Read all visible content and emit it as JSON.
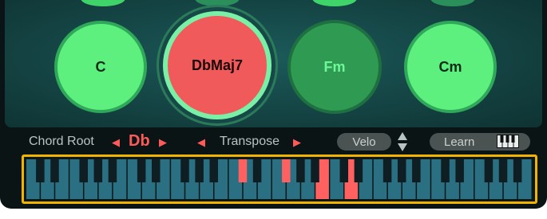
{
  "pads": {
    "top_colors": [
      "#3fd46a",
      "#2a8f5a",
      "#3fd46a",
      "#2a8f5a",
      "#3fd46a"
    ],
    "items": [
      {
        "label": "C",
        "state": "inactive",
        "fill": "#5ef07e",
        "ring": "#2fa85a",
        "text": "#0e2a18"
      },
      {
        "label": "DbMaj7",
        "state": "selected",
        "fill": "#f05a5a",
        "ring": "#7af0a6",
        "text": "#1a0808"
      },
      {
        "label": "Fm",
        "state": "playing",
        "fill": "#2f9a52",
        "ring": "#1f7040",
        "text": "#6ef79a"
      },
      {
        "label": "Cm",
        "state": "inactive",
        "fill": "#5ef07e",
        "ring": "#2fa85a",
        "text": "#0e2a18"
      }
    ]
  },
  "controls": {
    "chord_root_label": "Chord Root",
    "chord_root_value": "Db",
    "prev_icon": "◀",
    "next_icon": "▶",
    "transpose_label": "Transpose",
    "velo_label": "Velo",
    "learn_label": "Learn",
    "learn_icon": "piano-keys-icon",
    "accent": "#ff5a5a"
  },
  "keyboard": {
    "white_key_color": "#2b6f82",
    "black_key_color": "#0e1e22",
    "highlight_color": "#ff6060",
    "highlighted_black_keys": [
      10,
      12
    ],
    "highlighted_white_keys": [
      20,
      22
    ]
  }
}
